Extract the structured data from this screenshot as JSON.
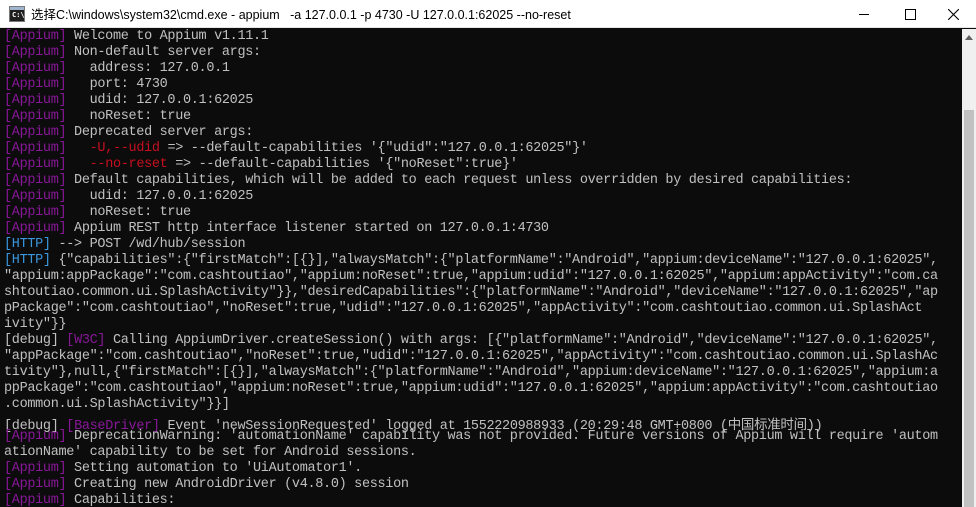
{
  "window": {
    "title": "选择C:\\windows\\system32\\cmd.exe - appium   -a 127.0.0.1 -p 4730 -U 127.0.0.1:62025 --no-reset",
    "controls": {
      "minimize": "—",
      "maximize": "☐",
      "close": "✕"
    }
  },
  "colors": {
    "background": "#0c0c0c",
    "text": "#c0c0c0",
    "appium_tag": "#881798",
    "http_tag": "#3a96dd",
    "red": "#c50f1f",
    "debug_tag": "#c0c0c0",
    "w3c_tag": "#881798",
    "basedriver_tag": "#881798"
  },
  "scrollbar": {
    "thumb_fraction": 0.86
  },
  "terminal": {
    "lines": [
      [
        {
          "t": "[Appium]",
          "c": "appium_tag"
        },
        {
          "t": " Welcome to Appium v1.11.1"
        }
      ],
      [
        {
          "t": "[Appium]",
          "c": "appium_tag"
        },
        {
          "t": " Non-default server args:"
        }
      ],
      [
        {
          "t": "[Appium]",
          "c": "appium_tag"
        },
        {
          "t": "   address: 127.0.0.1"
        }
      ],
      [
        {
          "t": "[Appium]",
          "c": "appium_tag"
        },
        {
          "t": "   port: 4730"
        }
      ],
      [
        {
          "t": "[Appium]",
          "c": "appium_tag"
        },
        {
          "t": "   udid: 127.0.0.1:62025"
        }
      ],
      [
        {
          "t": "[Appium]",
          "c": "appium_tag"
        },
        {
          "t": "   noReset: true"
        }
      ],
      [
        {
          "t": "[Appium]",
          "c": "appium_tag"
        },
        {
          "t": " Deprecated server args:"
        }
      ],
      [
        {
          "t": "[Appium]",
          "c": "appium_tag"
        },
        {
          "t": "   "
        },
        {
          "t": "-U,--udid",
          "c": "red"
        },
        {
          "t": " => --default-capabilities '{\"udid\":\"127.0.0.1:62025\"}'"
        }
      ],
      [
        {
          "t": "[Appium]",
          "c": "appium_tag"
        },
        {
          "t": "   "
        },
        {
          "t": "--no-reset",
          "c": "red"
        },
        {
          "t": " => --default-capabilities '{\"noReset\":true}'"
        }
      ],
      [
        {
          "t": "[Appium]",
          "c": "appium_tag"
        },
        {
          "t": " Default capabilities, which will be added to each request unless overridden by desired capabilities:"
        }
      ],
      [
        {
          "t": "[Appium]",
          "c": "appium_tag"
        },
        {
          "t": "   udid: 127.0.0.1:62025"
        }
      ],
      [
        {
          "t": "[Appium]",
          "c": "appium_tag"
        },
        {
          "t": "   noReset: true"
        }
      ],
      [
        {
          "t": "[Appium]",
          "c": "appium_tag"
        },
        {
          "t": " Appium REST http interface listener started on 127.0.0.1:4730"
        }
      ],
      [
        {
          "t": "[HTTP]",
          "c": "http_tag"
        },
        {
          "t": " --> POST /wd/hub/session"
        }
      ],
      [
        {
          "t": "[HTTP]",
          "c": "http_tag"
        },
        {
          "t": " {\"capabilities\":{\"firstMatch\":[{}],\"alwaysMatch\":{\"platformName\":\"Android\",\"appium:deviceName\":\"127.0.0.1:62025\","
        }
      ],
      [
        {
          "t": "\"appium:appPackage\":\"com.cashtoutiao\",\"appium:noReset\":true,\"appium:udid\":\"127.0.0.1:62025\",\"appium:appActivity\":\"com.ca"
        }
      ],
      [
        {
          "t": "shtoutiao.common.ui.SplashActivity\"}},\"desiredCapabilities\":{\"platformName\":\"Android\",\"deviceName\":\"127.0.0.1:62025\",\"ap"
        }
      ],
      [
        {
          "t": "pPackage\":\"com.cashtoutiao\",\"noReset\":true,\"udid\":\"127.0.0.1:62025\",\"appActivity\":\"com.cashtoutiao.common.ui.SplashAct"
        }
      ],
      [
        {
          "t": "ivity\"}}"
        }
      ],
      [
        {
          "t": "[debug]",
          "c": "debug_tag"
        },
        {
          "t": " "
        },
        {
          "t": "[W3C]",
          "c": "w3c_tag"
        },
        {
          "t": " Calling AppiumDriver.createSession() with args: [{\"platformName\":\"Android\",\"deviceName\":\"127.0.0.1:62025\","
        }
      ],
      [
        {
          "t": "\"appPackage\":\"com.cashtoutiao\",\"noReset\":true,\"udid\":\"127.0.0.1:62025\",\"appActivity\":\"com.cashtoutiao.common.ui.SplashAc"
        }
      ],
      [
        {
          "t": "tivity\"},null,{\"firstMatch\":[{}],\"alwaysMatch\":{\"platformName\":\"Android\",\"appium:deviceName\":\"127.0.0.1:62025\",\"appium:a"
        }
      ],
      [
        {
          "t": "ppPackage\":\"com.cashtoutiao\",\"appium:noReset\":true,\"appium:udid\":\"127.0.0.1:62025\",\"appium:appActivity\":\"com.cashtoutiao"
        }
      ],
      [
        {
          "t": ".common.ui.SplashActivity\"}}]"
        }
      ],
      [
        {
          "t": "[debug]",
          "c": "debug_tag"
        },
        {
          "t": " "
        },
        {
          "t": "[BaseDriver]",
          "c": "basedriver_tag"
        },
        {
          "t": " Event 'newSessionRequested' logged at 1552220988933 (20:29:48 GMT+0800 (中国标准时间))"
        }
      ],
      [
        {
          "t": "[Appium]",
          "c": "appium_tag"
        },
        {
          "t": " DeprecationWarning: 'automationName' capability was not provided. Future versions of Appium will require 'autom"
        }
      ],
      [
        {
          "t": "ationName' capability to be set for Android sessions."
        }
      ],
      [
        {
          "t": "[Appium]",
          "c": "appium_tag"
        },
        {
          "t": " Setting automation to 'UiAutomator1'."
        }
      ],
      [
        {
          "t": "[Appium]",
          "c": "appium_tag"
        },
        {
          "t": " Creating new AndroidDriver (v4.8.0) session"
        }
      ],
      [
        {
          "t": "[Appium]",
          "c": "appium_tag"
        },
        {
          "t": " Capabilities:"
        }
      ]
    ]
  }
}
